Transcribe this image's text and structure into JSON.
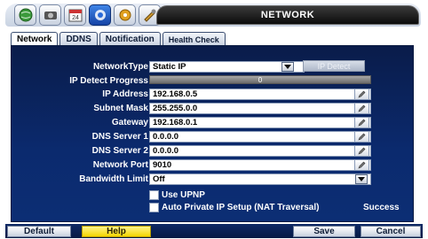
{
  "header": {
    "title": "NETWORK",
    "icons": [
      "globe-icon",
      "camera-icon",
      "calendar-icon",
      "network-icon",
      "tools-icon",
      "settings-icon"
    ],
    "calendar_text": "24"
  },
  "tabs": [
    {
      "label": "Network",
      "active": true
    },
    {
      "label": "DDNS",
      "active": false
    },
    {
      "label": "Notification",
      "active": false
    },
    {
      "label": "Health Check",
      "active": false
    }
  ],
  "form": {
    "network_type": {
      "label": "NetworkType",
      "value": "Static IP"
    },
    "ip_detect_button": "IP Detect",
    "ip_detect_progress": {
      "label": "IP Detect Progress",
      "value": "0"
    },
    "ip_address": {
      "label": "IP Address",
      "value": "192.168.0.5"
    },
    "subnet_mask": {
      "label": "Subnet Mask",
      "value": "255.255.0.0"
    },
    "gateway": {
      "label": "Gateway",
      "value": "192.168.0.1"
    },
    "dns1": {
      "label": "DNS Server 1",
      "value": "0.0.0.0"
    },
    "dns2": {
      "label": "DNS Server 2",
      "value": "0.0.0.0"
    },
    "network_port": {
      "label": "Network Port",
      "value": "9010"
    },
    "bandwidth_limit": {
      "label": "Bandwidth Limit",
      "value": "Off"
    },
    "use_upnp": {
      "label": "Use UPNP",
      "checked": false
    },
    "auto_private_ip": {
      "label": "Auto Private IP Setup (NAT Traversal)",
      "checked": false
    },
    "status": "Success"
  },
  "footer": {
    "default": "Default",
    "help": "Help",
    "save": "Save",
    "cancel": "Cancel"
  },
  "colors": {
    "panel": "#0b2a6e",
    "help_button": "#f4d600",
    "header_title_bg": "#111111"
  }
}
